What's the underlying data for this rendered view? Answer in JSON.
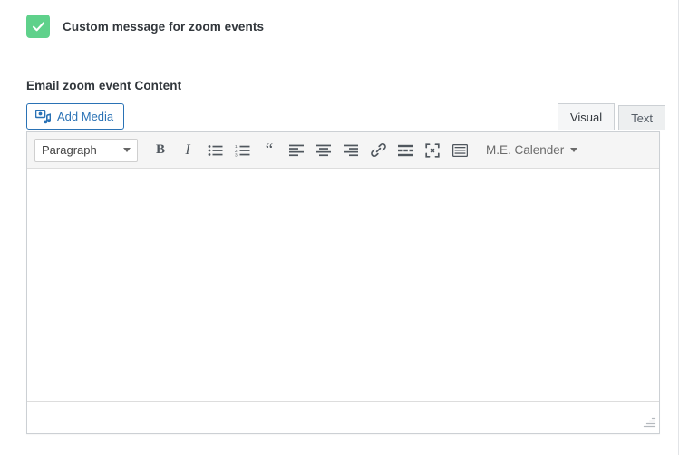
{
  "settings": {
    "custom_message_checkbox": {
      "label": "Custom message for zoom events",
      "checked": true,
      "icon": "check-icon",
      "accent_color": "#5fd18b"
    },
    "content_field": {
      "heading": "Email zoom event Content"
    }
  },
  "editor": {
    "add_media": {
      "label": "Add Media",
      "icon": "media-icon",
      "accent_color": "#2a72b5"
    },
    "tabs": [
      {
        "label": "Visual",
        "active": true
      },
      {
        "label": "Text",
        "active": false
      }
    ],
    "toolbar": {
      "format_select": {
        "value": "Paragraph",
        "caret_icon": "chevron-down-icon"
      },
      "buttons": [
        {
          "name": "bold-button",
          "glyph": "B",
          "title": "Bold"
        },
        {
          "name": "italic-button",
          "glyph": "I",
          "title": "Italic"
        },
        {
          "name": "bulleted-list-button",
          "icon": "bulleted-list-icon",
          "title": "Bulleted list"
        },
        {
          "name": "numbered-list-button",
          "icon": "numbered-list-icon",
          "title": "Numbered list"
        },
        {
          "name": "blockquote-button",
          "glyph": "“",
          "title": "Blockquote"
        },
        {
          "name": "align-left-button",
          "icon": "align-left-icon",
          "title": "Align left"
        },
        {
          "name": "align-center-button",
          "icon": "align-center-icon",
          "title": "Align center"
        },
        {
          "name": "align-right-button",
          "icon": "align-right-icon",
          "title": "Align right"
        },
        {
          "name": "insert-link-button",
          "icon": "link-icon",
          "title": "Insert/edit link"
        },
        {
          "name": "read-more-button",
          "icon": "read-more-icon",
          "title": "Insert Read More tag"
        },
        {
          "name": "fullscreen-button",
          "icon": "fullscreen-icon",
          "title": "Distraction-free writing mode"
        },
        {
          "name": "toolbar-toggle-button",
          "icon": "toolbar-toggle-icon",
          "title": "Toolbar Toggle"
        }
      ],
      "plugin_dropdown": {
        "label": "M.E. Calender",
        "caret_icon": "chevron-down-icon"
      }
    },
    "canvas": {
      "value": "",
      "placeholder": ""
    },
    "statusbar": {
      "resize_handle_icon": "resize-grip-icon"
    }
  }
}
